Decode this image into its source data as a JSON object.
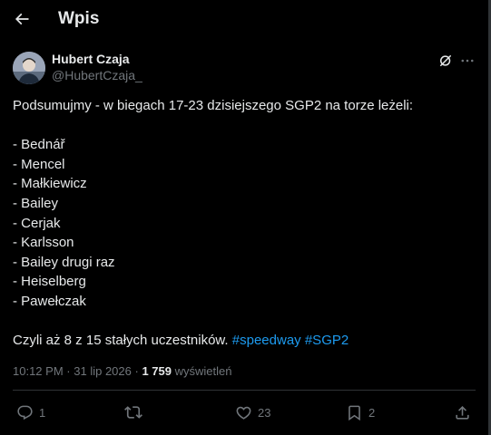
{
  "header": {
    "title": "Wpis",
    "back_icon": "arrow-left-icon"
  },
  "author": {
    "name": "Hubert Czaja",
    "handle": "@HubertCzaja_"
  },
  "tweet": {
    "intro": "Podsumujmy - w biegach 17-23 dzisiejszego SGP2 na torze leżeli:",
    "riders": [
      "- Bednář",
      "- Mencel",
      "- Małkiewicz",
      "- Bailey",
      "- Cerjak",
      "- Karlsson",
      "- Bailey drugi raz",
      "- Heiselberg",
      "- Pawełczak"
    ],
    "outro": "Czyli aż 8 z 15 stałych uczestników.",
    "hashtags": [
      "#speedway",
      "#SGP2"
    ]
  },
  "meta": {
    "time": "10:12 PM",
    "date": "31 lip 2026",
    "separator": "·",
    "views_count": "1 759",
    "views_label": "wyświetleń"
  },
  "actions": {
    "replies": "1",
    "reposts": "",
    "likes": "23",
    "bookmarks": "2"
  },
  "colors": {
    "background": "#000000",
    "text": "#e7e9ea",
    "secondary": "#71767b",
    "accent": "#1d9bf0",
    "divider": "#2f3336"
  }
}
